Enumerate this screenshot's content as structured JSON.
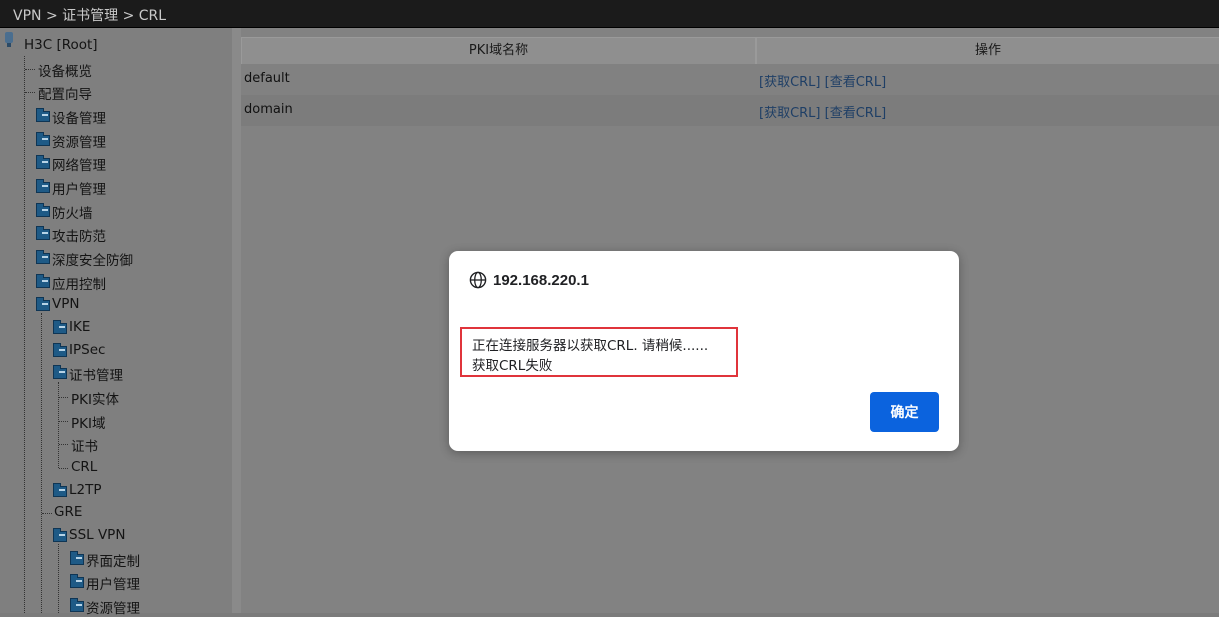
{
  "breadcrumb": "VPN > 证书管理 > CRL",
  "tree": {
    "root": "H3C [Root]",
    "items": [
      {
        "label": "设备概览"
      },
      {
        "label": "配置向导"
      },
      {
        "label": "设备管理"
      },
      {
        "label": "资源管理"
      },
      {
        "label": "网络管理"
      },
      {
        "label": "用户管理"
      },
      {
        "label": "防火墙"
      },
      {
        "label": "攻击防范"
      },
      {
        "label": "深度安全防御"
      },
      {
        "label": "应用控制"
      },
      {
        "label": "VPN"
      },
      {
        "label": "IKE"
      },
      {
        "label": "IPSec"
      },
      {
        "label": "证书管理"
      },
      {
        "label": "PKI实体"
      },
      {
        "label": "PKI域"
      },
      {
        "label": "证书"
      },
      {
        "label": "CRL"
      },
      {
        "label": "L2TP"
      },
      {
        "label": "GRE"
      },
      {
        "label": "SSL VPN"
      },
      {
        "label": "界面定制"
      },
      {
        "label": "用户管理"
      },
      {
        "label": "资源管理"
      }
    ]
  },
  "table": {
    "headers": [
      "PKI域名称",
      "操作"
    ],
    "rows": [
      {
        "name": "default",
        "get_crl": "[获取CRL]",
        "view_crl": "[查看CRL]"
      },
      {
        "name": "domain",
        "get_crl": "[获取CRL]",
        "view_crl": "[查看CRL]"
      }
    ]
  },
  "dialog": {
    "origin": "192.168.220.1",
    "icon": "globe-icon",
    "message_line1": "正在连接服务器以获取CRL. 请稍候......",
    "message_line2": "获取CRL失败",
    "ok_label": "确定",
    "highlight_color": "#e0343b",
    "button_color": "#0b63de"
  }
}
